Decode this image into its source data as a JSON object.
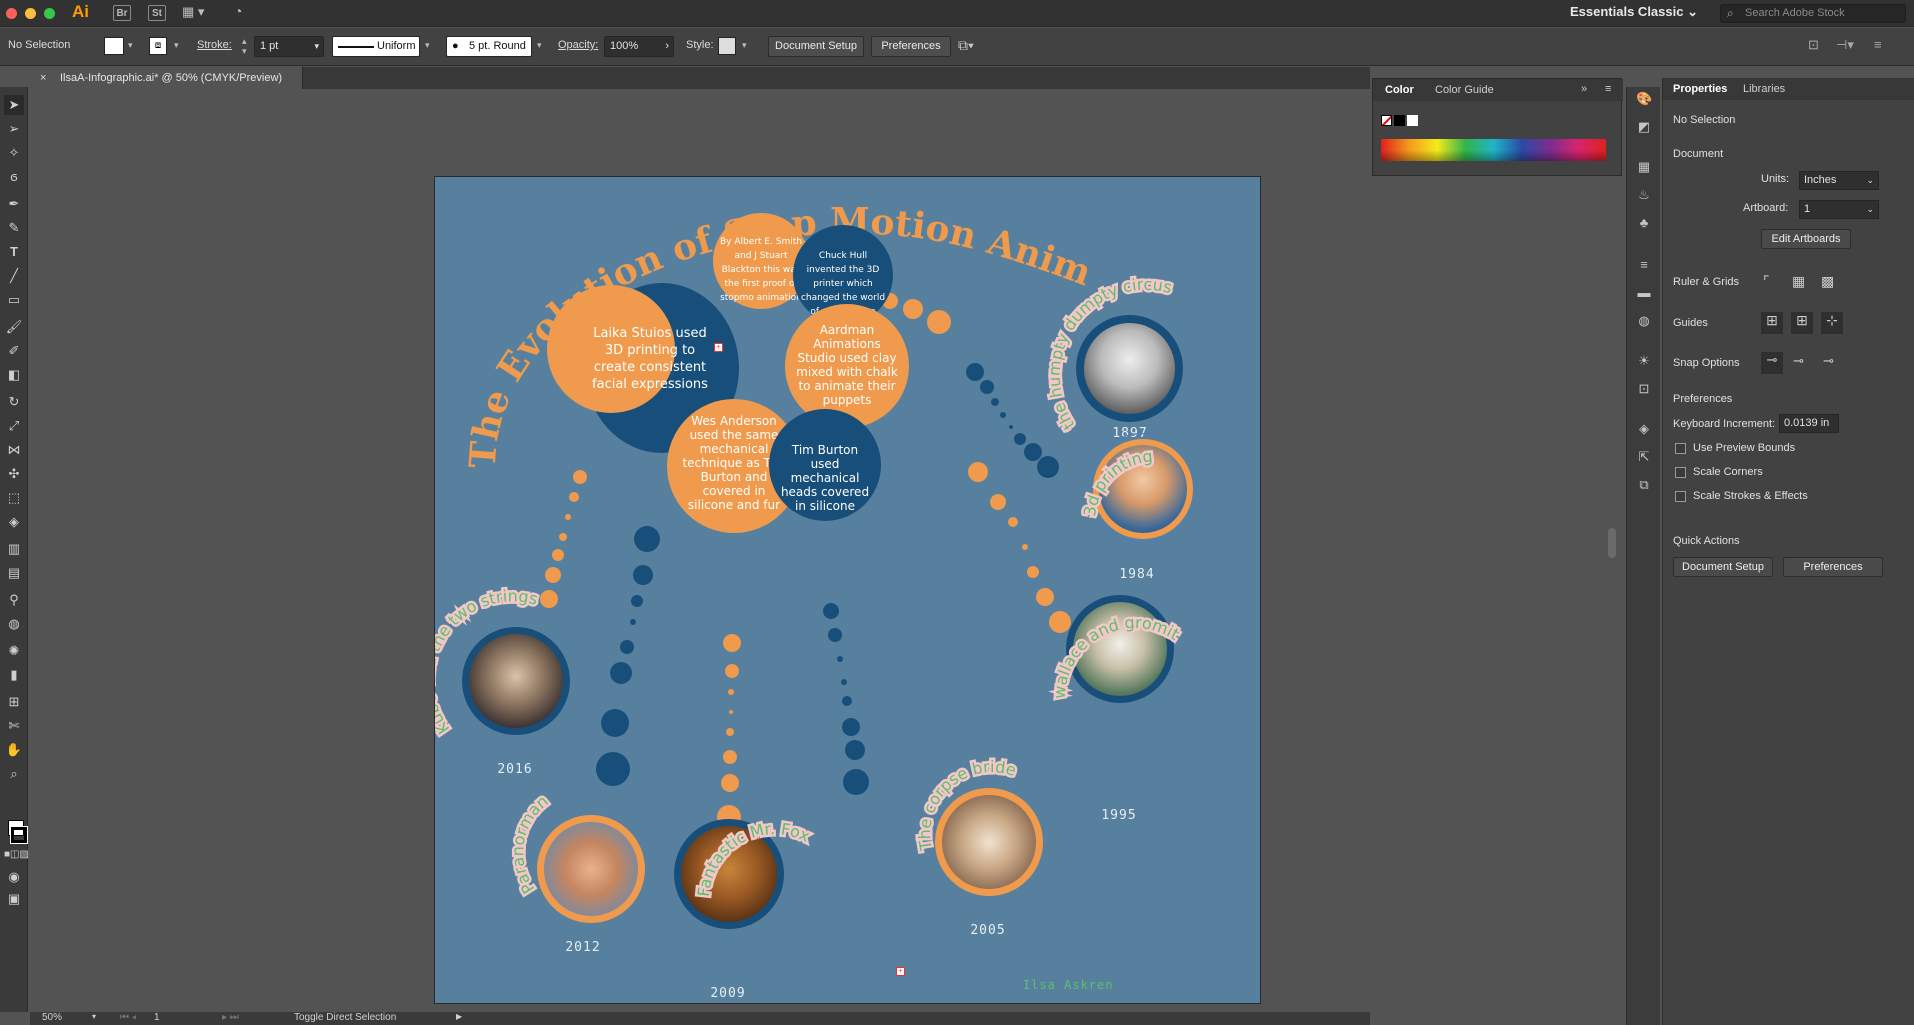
{
  "app": {
    "name": "Ai",
    "bridge": "Br",
    "stock": "St",
    "workspace": "Essentials Classic",
    "search_placeholder": "Search Adobe Stock"
  },
  "control_bar": {
    "selection": "No Selection",
    "stroke_label": "Stroke:",
    "stroke_value": "1 pt",
    "profile": "Uniform",
    "brush": "5 pt. Round",
    "opacity_label": "Opacity:",
    "opacity_value": "100%",
    "style_label": "Style:",
    "document_setup": "Document Setup",
    "preferences": "Preferences"
  },
  "document": {
    "tab_title": "IlsaA-Infographic.ai* @ 50% (CMYK/Preview)",
    "close": "×"
  },
  "artboard": {
    "title": "The Evolution of Stop Motion Animation",
    "author": "Ilsa Askren",
    "circles": {
      "albert": "By Albert E. Smith and J Stuart Blackton this was the first proof of stopmo animation",
      "hull": "Chuck Hull invented the 3D printer which changed the world of stop motion animation",
      "laika": "Laika Stuios used 3D printing to create consistent facial expressions",
      "aardman": "Aardman Animations Studio used clay mixed with chalk to animate their puppets",
      "anderson": "Wes Anderson used the same mechanical technique as Tim Burton and covered in silicone and fur",
      "burton": "Tim Burton used mechanical heads covered in silicone"
    },
    "films": [
      {
        "label": "the humpty dumpty circus",
        "year": "1897"
      },
      {
        "label": "3d printing",
        "year": "1984"
      },
      {
        "label": "wallace and gromit",
        "year": "1995"
      },
      {
        "label": "The corpse bride",
        "year": "2005"
      },
      {
        "label": "Fantastic Mr. Fox",
        "year": "2009"
      },
      {
        "label": "Paranorman",
        "year": "2012"
      },
      {
        "label": "Kubo and the two strings",
        "year": "2016"
      }
    ]
  },
  "status_bar": {
    "zoom": "50%",
    "artboard_num": "1",
    "tool_hint": "Toggle Direct Selection"
  },
  "color_panel": {
    "tab_color": "Color",
    "tab_guide": "Color Guide"
  },
  "properties": {
    "tab_properties": "Properties",
    "tab_libraries": "Libraries",
    "selection": "No Selection",
    "document_heading": "Document",
    "units_label": "Units:",
    "units_value": "Inches",
    "artboard_label": "Artboard:",
    "artboard_value": "1",
    "edit_artboards": "Edit Artboards",
    "ruler_grids": "Ruler & Grids",
    "guides": "Guides",
    "snap_options": "Snap Options",
    "preferences_heading": "Preferences",
    "keyboard_increment_label": "Keyboard Increment:",
    "keyboard_increment_value": "0.0139 in",
    "use_preview_bounds": "Use Preview Bounds",
    "scale_corners": "Scale Corners",
    "scale_strokes": "Scale Strokes & Effects",
    "quick_actions": "Quick Actions",
    "qa_document_setup": "Document Setup",
    "qa_preferences": "Preferences"
  },
  "colors": {
    "orange": "#ef9a4c",
    "navy": "#174f7a",
    "artboard": "#57809f",
    "label_green": "#5cbf6a",
    "label_bg": "#f3c7c9"
  }
}
